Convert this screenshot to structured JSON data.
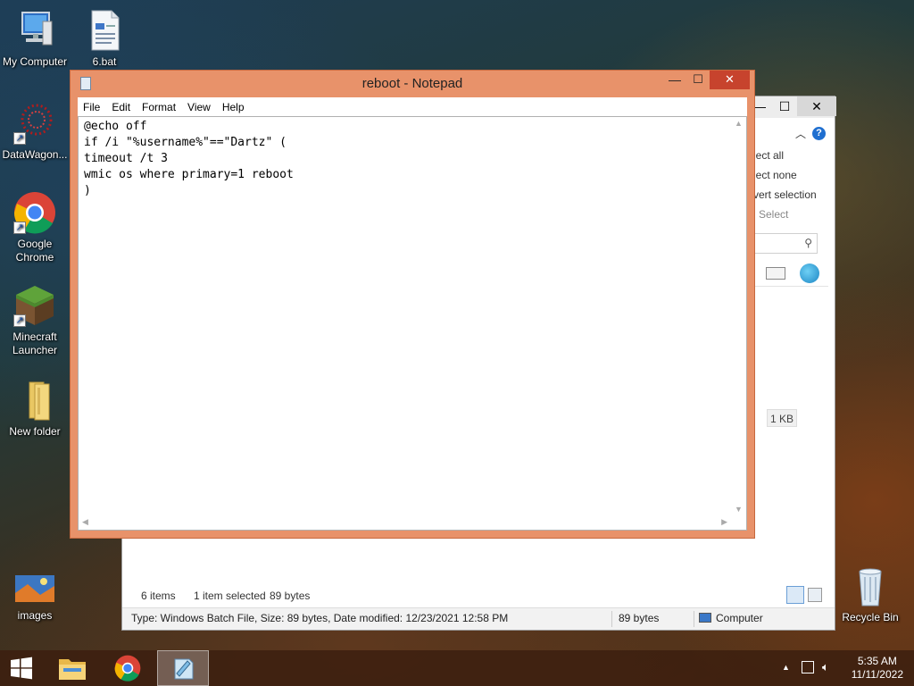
{
  "desktop": {
    "icons": [
      {
        "label": "My Computer"
      },
      {
        "label": "6.bat"
      },
      {
        "label": "DataWagon..."
      },
      {
        "label": "Google Chrome"
      },
      {
        "label": "Minecraft Launcher"
      },
      {
        "label": "New folder"
      },
      {
        "label": "images"
      },
      {
        "label": "Recycle Bin"
      }
    ]
  },
  "explorer": {
    "ribbon": {
      "select_all": "lect all",
      "select_none": "lect none",
      "invert_selection": "vert selection",
      "group_label": "Select"
    },
    "size_cell": "1 KB",
    "status": {
      "items": "6 items",
      "selected": "1 item selected",
      "selected_size": "89 bytes"
    },
    "details": {
      "info": "Type: Windows Batch File, Size: 89 bytes, Date modified: 12/23/2021 12:58 PM",
      "size": "89 bytes",
      "location": "Computer"
    }
  },
  "notepad": {
    "title": "reboot - Notepad",
    "menu": [
      "File",
      "Edit",
      "Format",
      "View",
      "Help"
    ],
    "content": "@echo off\nif /i \"%username%\"==\"Dartz\" (\ntimeout /t 3\nwmic os where primary=1 reboot\n)"
  },
  "taskbar": {
    "time": "5:35 AM",
    "date": "11/11/2022"
  },
  "colors": {
    "notepad_frame": "#e8926a",
    "close_button": "#c7432d",
    "taskbar": "#3c1e0f"
  }
}
